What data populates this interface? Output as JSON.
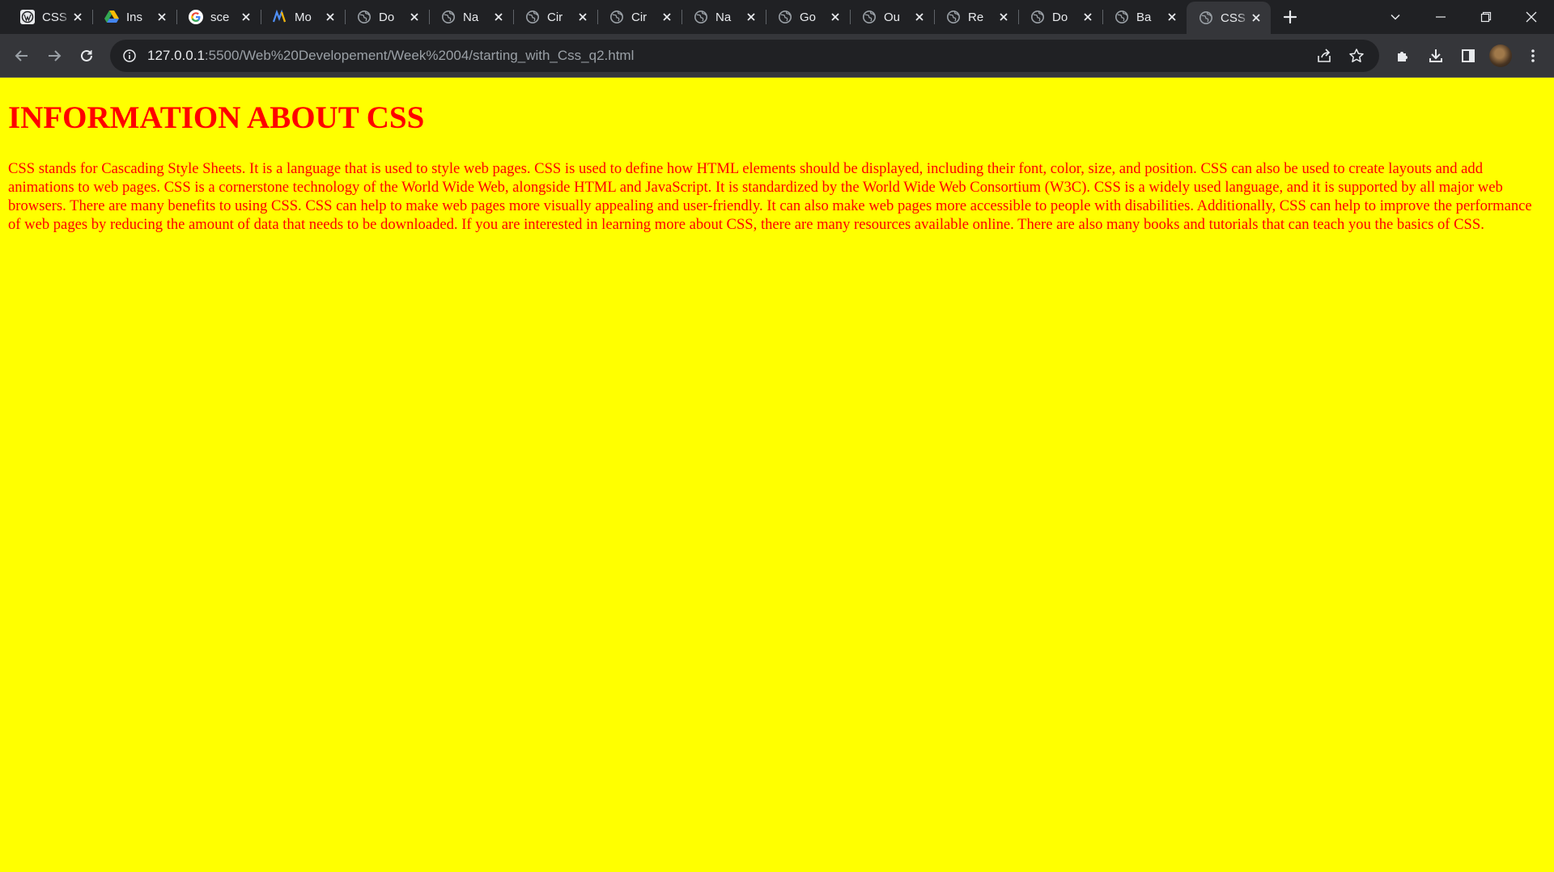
{
  "browser": {
    "tabs": [
      {
        "title": "CSS",
        "icon": "wordpress-icon",
        "active": false
      },
      {
        "title": "Ins",
        "icon": "google-drive-icon",
        "active": false
      },
      {
        "title": "sce",
        "icon": "google-icon",
        "active": false
      },
      {
        "title": "Mo",
        "icon": "app-logo-icon",
        "active": false
      },
      {
        "title": "Do",
        "icon": "globe-icon",
        "active": false
      },
      {
        "title": "Na",
        "icon": "globe-icon",
        "active": false
      },
      {
        "title": "Cir",
        "icon": "globe-icon",
        "active": false
      },
      {
        "title": "Cir",
        "icon": "globe-icon",
        "active": false
      },
      {
        "title": "Na",
        "icon": "globe-icon",
        "active": false
      },
      {
        "title": "Go",
        "icon": "globe-icon",
        "active": false
      },
      {
        "title": "Ou",
        "icon": "globe-icon",
        "active": false
      },
      {
        "title": "Re",
        "icon": "globe-icon",
        "active": false
      },
      {
        "title": "Do",
        "icon": "globe-icon",
        "active": false
      },
      {
        "title": "Ba",
        "icon": "globe-icon",
        "active": false
      },
      {
        "title": "CSS",
        "icon": "globe-icon",
        "active": true
      }
    ],
    "url_host": "127.0.0.1",
    "url_rest": ":5500/Web%20Developement/Week%2004/starting_with_Css_q2.html",
    "colors": {
      "chrome_dark": "#202124",
      "chrome_toolbar": "#35363a"
    }
  },
  "page": {
    "heading": "INFORMATION ABOUT CSS",
    "paragraph": "CSS stands for Cascading Style Sheets. It is a language that is used to style web pages. CSS is used to define how HTML elements should be displayed, including their font, color, size, and position. CSS can also be used to create layouts and add animations to web pages. CSS is a cornerstone technology of the World Wide Web, alongside HTML and JavaScript. It is standardized by the World Wide Web Consortium (W3C). CSS is a widely used language, and it is supported by all major web browsers. There are many benefits to using CSS. CSS can help to make web pages more visually appealing and user-friendly. It can also make web pages more accessible to people with disabilities. Additionally, CSS can help to improve the performance of web pages by reducing the amount of data that needs to be downloaded. If you are interested in learning more about CSS, there are many resources available online. There are also many books and tutorials that can teach you the basics of CSS.",
    "colors": {
      "background": "#ffff00",
      "text": "#ff0000"
    }
  }
}
